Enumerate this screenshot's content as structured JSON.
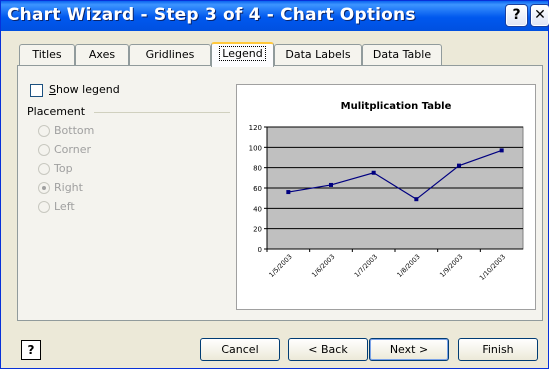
{
  "window": {
    "title": "Chart Wizard - Step 3 of 4 - Chart Options",
    "help_glyph": "?",
    "close_glyph": "✕"
  },
  "tabs": [
    {
      "label": "Titles",
      "active": false
    },
    {
      "label": "Axes",
      "active": false
    },
    {
      "label": "Gridlines",
      "active": false
    },
    {
      "label": "Legend",
      "active": true
    },
    {
      "label": "Data Labels",
      "active": false
    },
    {
      "label": "Data Table",
      "active": false
    }
  ],
  "legend": {
    "show_legend_label": "Show legend",
    "show_legend_checked": false,
    "placement_title": "Placement",
    "placements": [
      {
        "label": "Bottom",
        "selected": false
      },
      {
        "label": "Corner",
        "selected": false
      },
      {
        "label": "Top",
        "selected": false
      },
      {
        "label": "Right",
        "selected": true
      },
      {
        "label": "Left",
        "selected": false
      }
    ]
  },
  "buttons": {
    "help_icon": "?",
    "cancel": "Cancel",
    "back": "< Back",
    "next": "Next >",
    "finish": "Finish"
  },
  "chart_data": {
    "type": "line",
    "title": "Mulitplication Table",
    "categories": [
      "1/5/2003",
      "1/6/2003",
      "1/7/2003",
      "1/8/2003",
      "1/9/2003",
      "1/10/2003"
    ],
    "series": [
      {
        "values": [
          56,
          63,
          75,
          49,
          82,
          97
        ],
        "color": "#000080"
      }
    ],
    "ylim": [
      0,
      120
    ],
    "yticks": [
      0,
      20,
      40,
      60,
      80,
      100,
      120
    ],
    "plot_background": "#c0c0c0",
    "gridlines": true,
    "legend": "none"
  }
}
